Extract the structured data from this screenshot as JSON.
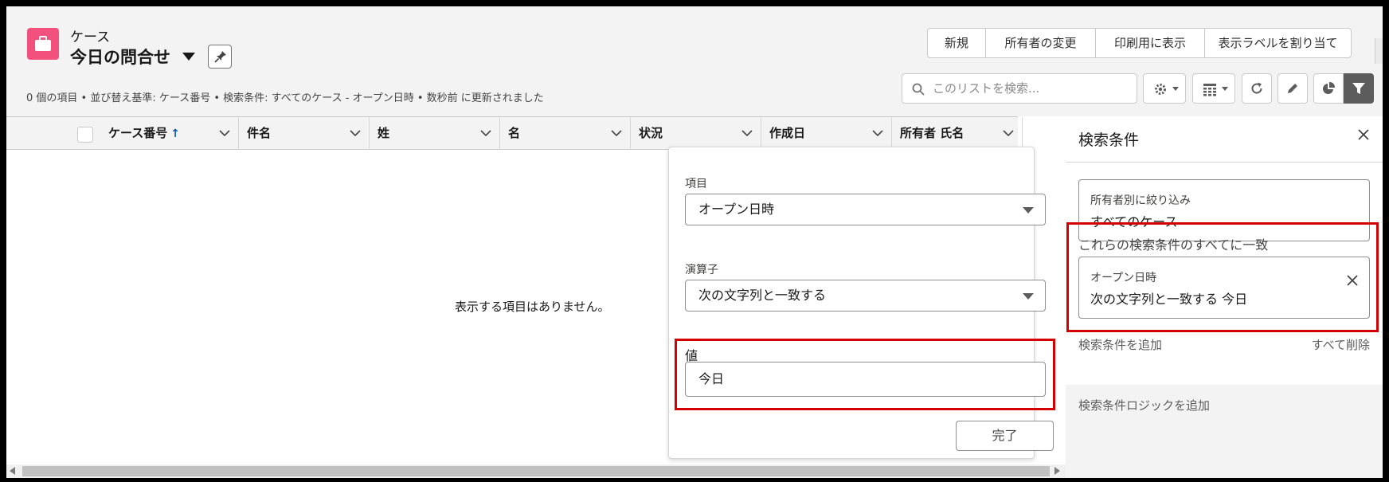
{
  "header": {
    "object_label": "ケース",
    "list_title": "今日の問合せ",
    "status_line": "0 個の項目 • 並び替え基準: ケース番号 • 検索条件: すべてのケース - オープン日時 • 数秒前 に更新されました",
    "app_icon": "briefcase-icon",
    "app_icon_color": "#f2517e",
    "actions": [
      "新規",
      "所有者の変更",
      "印刷用に表示",
      "表示ラベルを割り当て"
    ],
    "search_placeholder": "このリストを検索...",
    "toolbar_icons": [
      "gear-icon",
      "table-icon",
      "refresh-icon",
      "pencil-icon",
      "pie-chart-icon",
      "filter-icon"
    ]
  },
  "table": {
    "columns": [
      "ケース番号",
      "件名",
      "姓",
      "名",
      "状況",
      "作成日",
      "所有者 氏名"
    ],
    "sort_indicator": "↑",
    "empty_message": "表示する項目はありません。"
  },
  "popover": {
    "field_label": "項目",
    "field_value": "オープン日時",
    "operator_label": "演算子",
    "operator_value": "次の文字列と一致する",
    "value_label": "値",
    "value_value": "今日",
    "done_label": "完了",
    "highlight_color": "#d40000"
  },
  "panel": {
    "title": "検索条件",
    "owner_filter_label": "所有者別に絞り込み",
    "owner_filter_value": "すべてのケース",
    "match_all_label": "これらの検索条件のすべてに一致",
    "condition_field": "オープン日時",
    "condition_value": "次の文字列と一致する  今日",
    "add_filter": "検索条件を追加",
    "remove_all": "すべて削除",
    "add_logic": "検索条件ロジックを追加"
  }
}
